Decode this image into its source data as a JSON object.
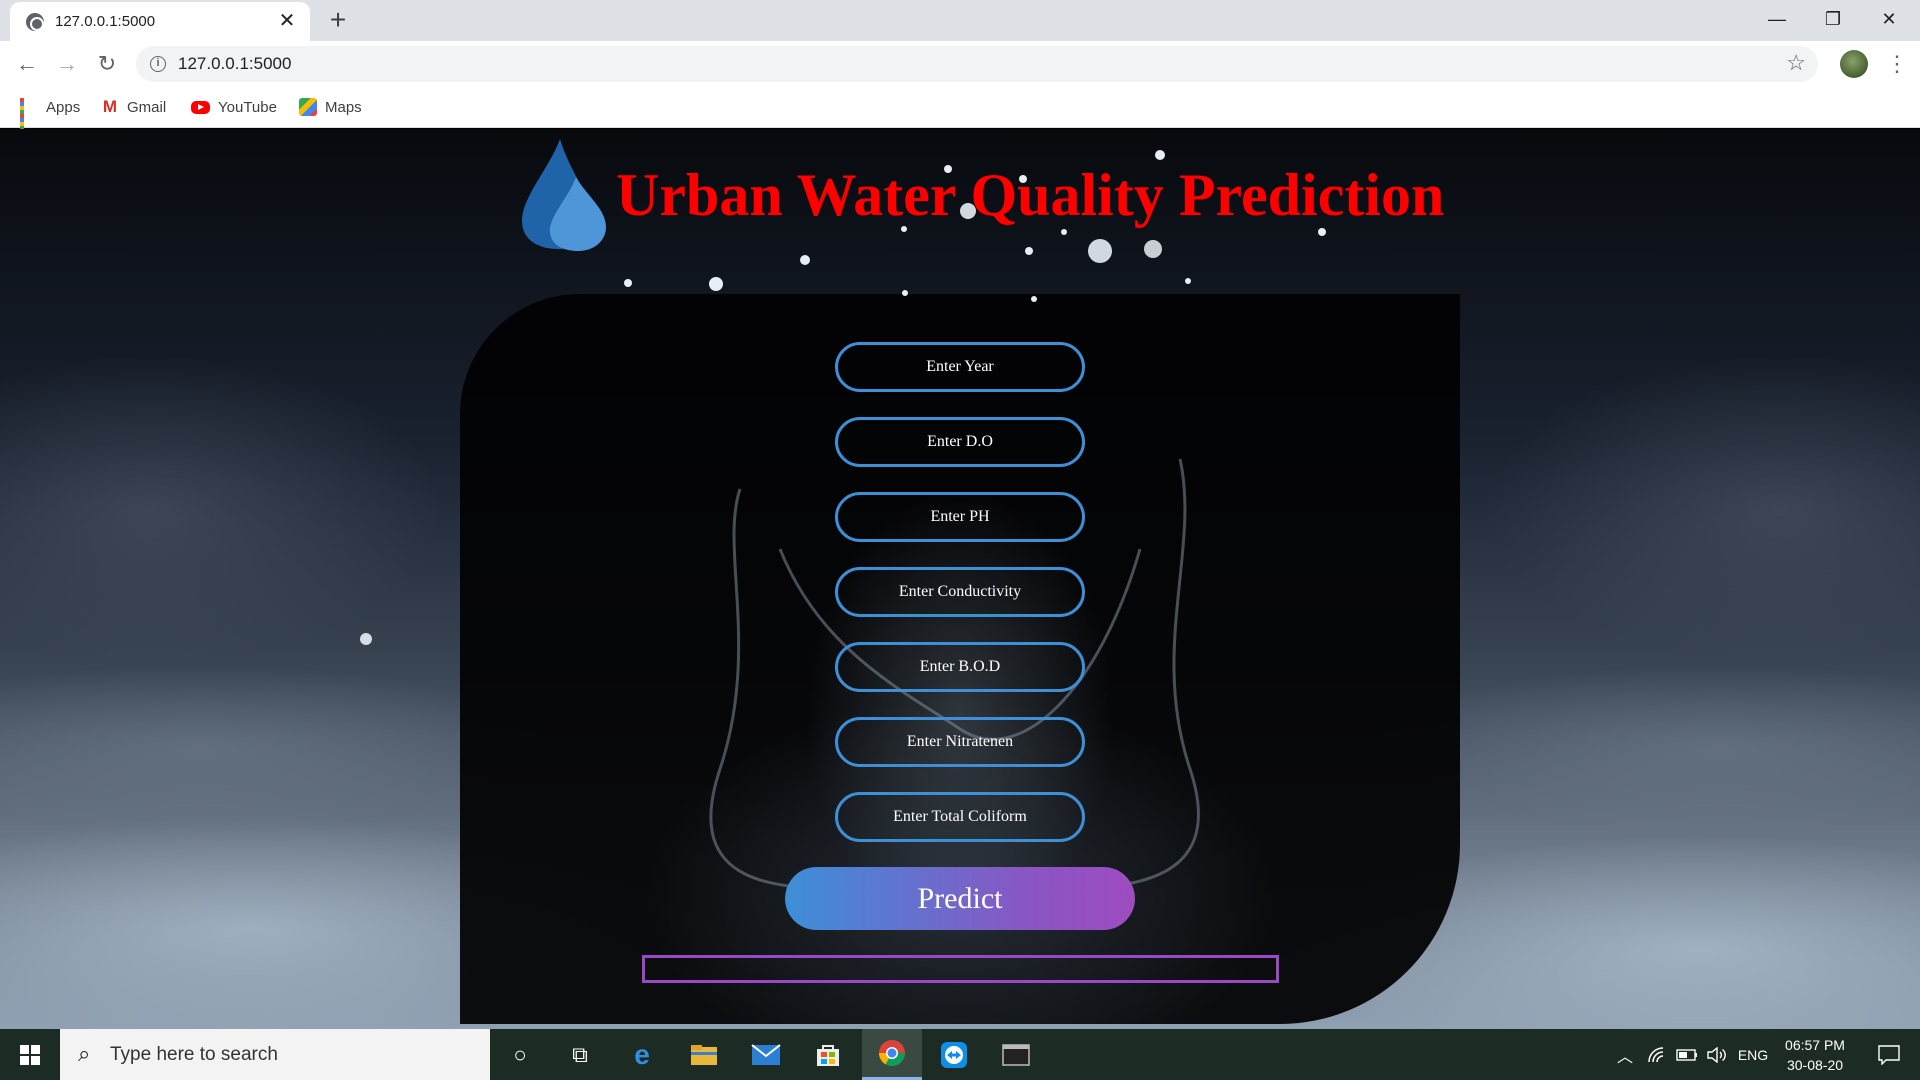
{
  "browser": {
    "tab_title": "127.0.0.1:5000",
    "tab_close": "✕",
    "new_tab": "+",
    "url": "127.0.0.1:5000",
    "window_controls": {
      "minimize": "—",
      "restore": "❐",
      "close": "✕"
    },
    "bookmarks": [
      {
        "label": "Apps",
        "icon": "apps-grid-icon"
      },
      {
        "label": "Gmail",
        "icon": "gmail-icon"
      },
      {
        "label": "YouTube",
        "icon": "youtube-icon"
      },
      {
        "label": "Maps",
        "icon": "maps-icon"
      }
    ]
  },
  "page": {
    "title": "Urban Water Quality Prediction",
    "title_color": "#ff0000",
    "accent_blue": "#3f8fd6",
    "accent_purple": "#9a48c8",
    "fields": [
      {
        "placeholder": "Enter Year"
      },
      {
        "placeholder": "Enter D.O"
      },
      {
        "placeholder": "Enter PH"
      },
      {
        "placeholder": "Enter Conductivity"
      },
      {
        "placeholder": "Enter B.O.D"
      },
      {
        "placeholder": "Enter Nitratenen"
      },
      {
        "placeholder": "Enter Total Coliform"
      }
    ],
    "predict_label": "Predict",
    "result_text": ""
  },
  "taskbar": {
    "search_placeholder": "Type here to search",
    "language": "ENG",
    "time": "06:57 PM",
    "date": "30-08-20"
  }
}
